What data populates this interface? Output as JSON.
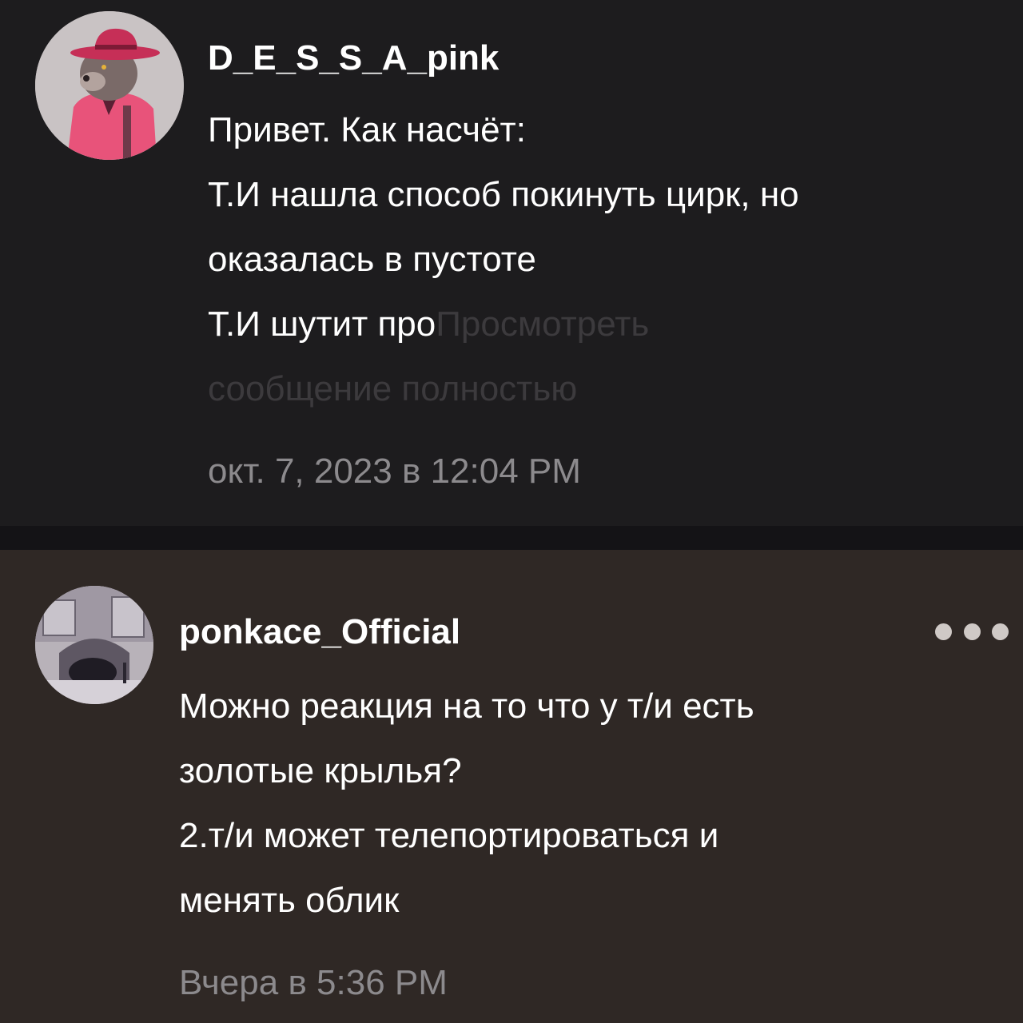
{
  "messages": [
    {
      "username": "D_E_S_S_A_pink",
      "avatar_icon": "bear-avatar-icon",
      "lines": [
        "Привет. Как насчёт:",
        "Т.И нашла способ покинуть цирк, но",
        "оказалась в пустоте"
      ],
      "truncated_line": "Т.И шутит про",
      "see_more_part1": "Просмотреть",
      "see_more_part2": "сообщение полностью",
      "timestamp": "окт. 7, 2023 в 12:04 PM"
    },
    {
      "username": "ponkace_Official",
      "avatar_icon": "room-scene-avatar-icon",
      "lines": [
        "Можно реакция на то что у т/и есть",
        "золотые крылья?",
        "2.т/и может телепортироваться и",
        "менять облик"
      ],
      "timestamp": "Вчера в 5:36 PM",
      "more_icon": "more-dots-icon"
    }
  ],
  "colors": {
    "message_bg_1": "#1d1c1e",
    "message_bg_2": "#2f2825",
    "divider": "#141316",
    "text": "#ffffff",
    "timestamp": "#8c8a8d",
    "see_more": "#3c3a3d"
  }
}
